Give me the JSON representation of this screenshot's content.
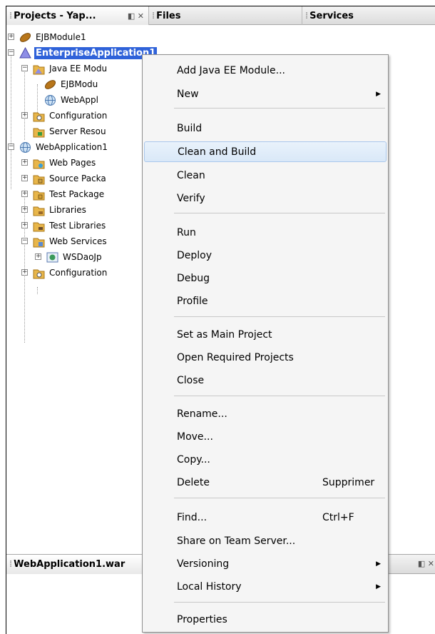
{
  "tabs": [
    {
      "label": "Projects - Yap..."
    },
    {
      "label": "Files"
    },
    {
      "label": "Services"
    }
  ],
  "tree": {
    "ejbmodule1": "EJBModule1",
    "enterprise_app": "EnterpriseApplication1",
    "java_ee_modules": "Java EE Modu",
    "ejb_child": "EJBModu",
    "webapp_child": "WebAppl",
    "configuration1": "Configuration",
    "server_resources": "Server Resou",
    "webapplication1": "WebApplication1",
    "web_pages": "Web Pages",
    "source_packages": "Source Packa",
    "test_packages": "Test Package",
    "libraries": "Libraries",
    "test_libraries": "Test Libraries",
    "web_services": "Web Services",
    "wsdao": "WSDaoJp",
    "configuration2": "Configuration"
  },
  "bottom_panel": {
    "title": "WebApplication1.war"
  },
  "context_menu": {
    "items": [
      {
        "label": "Add Java EE Module..."
      },
      {
        "label": "New",
        "submenu": true
      },
      {
        "label": "Build"
      },
      {
        "label": "Clean and Build",
        "highlighted": true
      },
      {
        "label": "Clean"
      },
      {
        "label": "Verify"
      },
      {
        "label": "Run"
      },
      {
        "label": "Deploy"
      },
      {
        "label": "Debug"
      },
      {
        "label": "Profile"
      },
      {
        "label": "Set as Main Project"
      },
      {
        "label": "Open Required Projects"
      },
      {
        "label": "Close"
      },
      {
        "label": "Rename..."
      },
      {
        "label": "Move..."
      },
      {
        "label": "Copy..."
      },
      {
        "label": "Delete",
        "shortcut": "Supprimer"
      },
      {
        "label": "Find...",
        "shortcut": "Ctrl+F"
      },
      {
        "label": "Share on Team Server..."
      },
      {
        "label": "Versioning",
        "submenu": true
      },
      {
        "label": "Local History",
        "submenu": true
      },
      {
        "label": "Properties"
      }
    ]
  },
  "colors": {
    "selection": "#2f62d9",
    "menu_highlight": "#d9e8f8"
  }
}
